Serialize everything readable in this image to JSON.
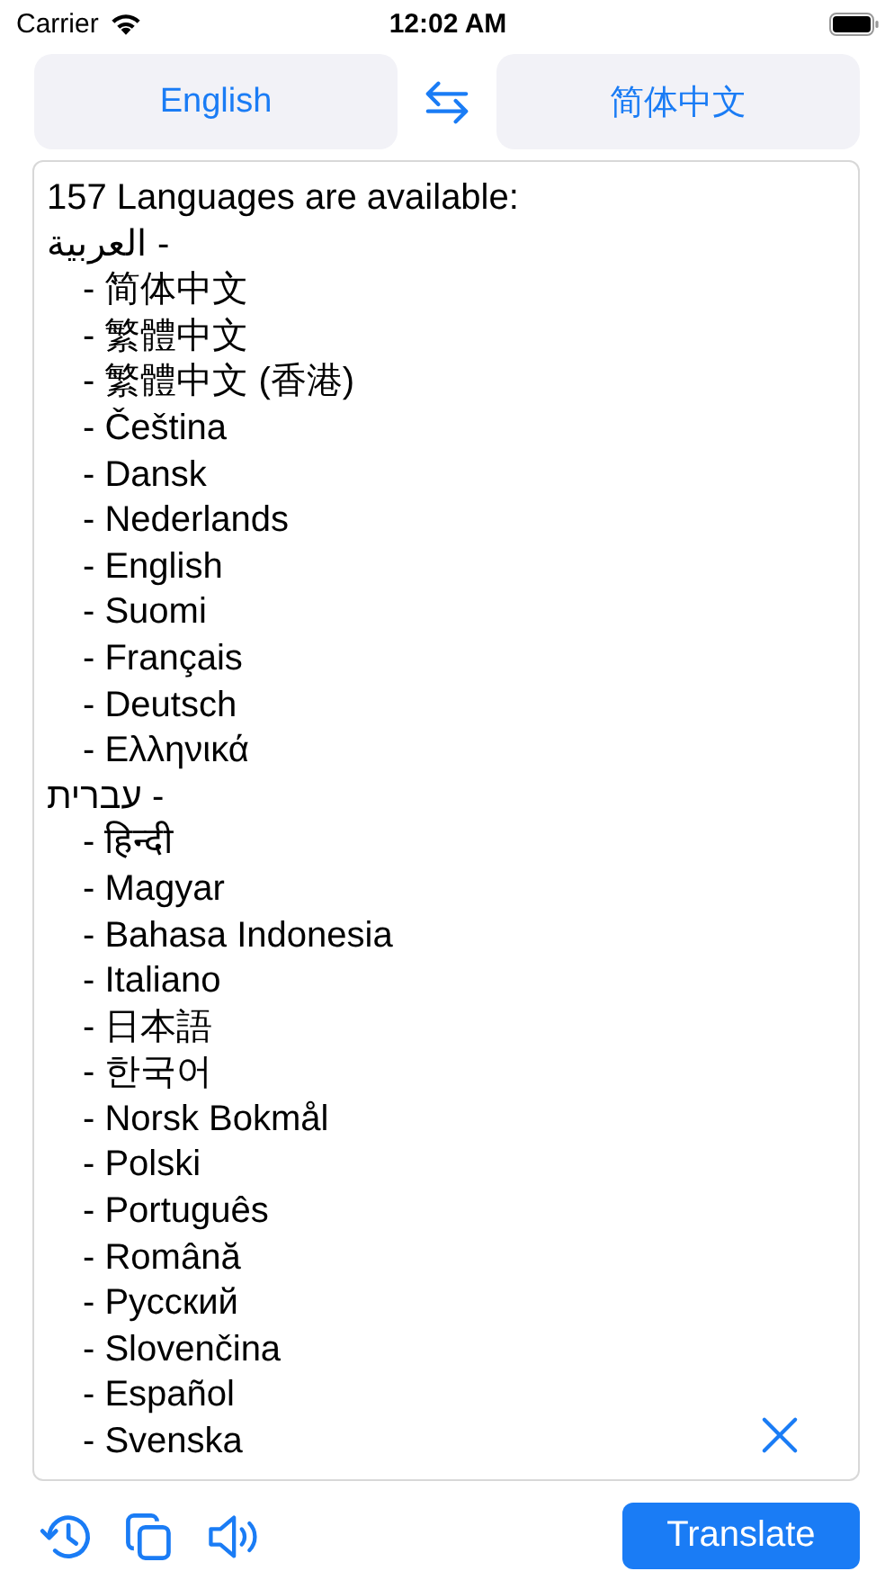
{
  "status_bar": {
    "carrier": "Carrier",
    "time": "12:02 AM"
  },
  "language_bar": {
    "source": "English",
    "target": "简体中文"
  },
  "text_view": {
    "heading": "157 Languages are available:",
    "entries": [
      {
        "text": "- العربية",
        "children": [
          {
            "text": "- 简体中文"
          },
          {
            "text": "- 繁體中文"
          },
          {
            "text": "- 繁體中文 (香港)"
          },
          {
            "text": "- Čeština"
          },
          {
            "text": "- Dansk"
          },
          {
            "text": "- Nederlands"
          },
          {
            "text": "- English"
          },
          {
            "text": "- Suomi"
          },
          {
            "text": "- Français"
          },
          {
            "text": "- Deutsch"
          },
          {
            "text": "- Ελληνικά"
          }
        ]
      },
      {
        "text": "- עברית",
        "children": [
          {
            "text": "- हिन्दी"
          },
          {
            "text": "- Magyar"
          },
          {
            "text": "- Bahasa Indonesia"
          },
          {
            "text": "- Italiano"
          },
          {
            "text": "- 日本語"
          },
          {
            "text": "- 한국어"
          },
          {
            "text": "- Norsk Bokmål"
          },
          {
            "text": "- Polski"
          },
          {
            "text": "- Português"
          },
          {
            "text": "- Română"
          },
          {
            "text": "- Русский"
          },
          {
            "text": "- Slovenčina"
          },
          {
            "text": "- Español"
          },
          {
            "text": "- Svenska"
          }
        ]
      }
    ]
  },
  "toolbar": {
    "translate_button": "Translate"
  }
}
